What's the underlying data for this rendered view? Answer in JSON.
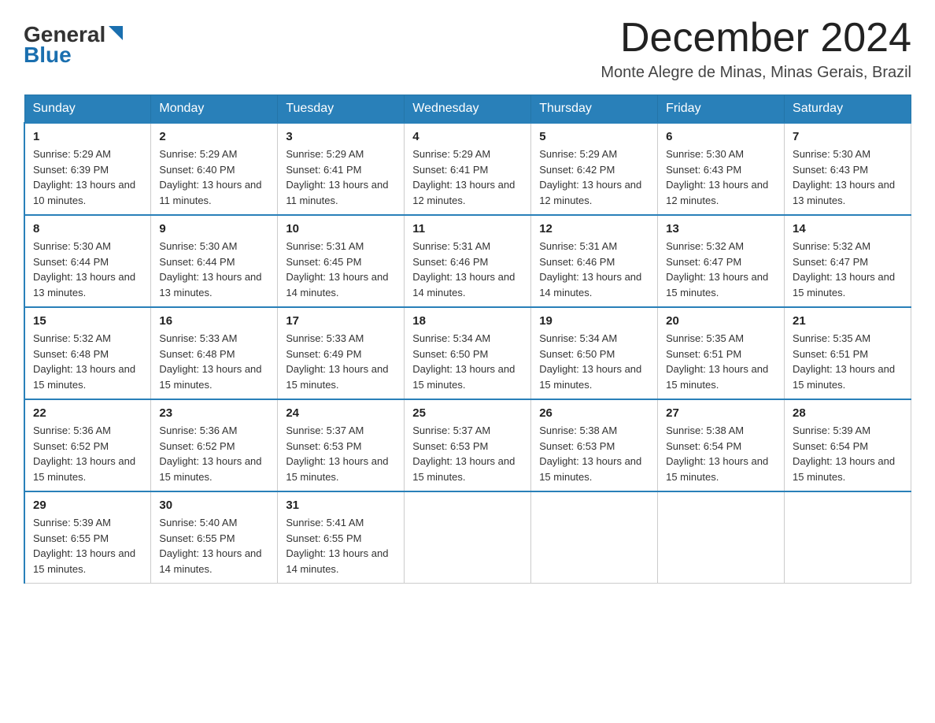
{
  "logo": {
    "line1": "General",
    "line2": "Blue"
  },
  "title": "December 2024",
  "subtitle": "Monte Alegre de Minas, Minas Gerais, Brazil",
  "weekdays": [
    "Sunday",
    "Monday",
    "Tuesday",
    "Wednesday",
    "Thursday",
    "Friday",
    "Saturday"
  ],
  "weeks": [
    [
      {
        "day": "1",
        "sunrise": "5:29 AM",
        "sunset": "6:39 PM",
        "daylight": "13 hours and 10 minutes."
      },
      {
        "day": "2",
        "sunrise": "5:29 AM",
        "sunset": "6:40 PM",
        "daylight": "13 hours and 11 minutes."
      },
      {
        "day": "3",
        "sunrise": "5:29 AM",
        "sunset": "6:41 PM",
        "daylight": "13 hours and 11 minutes."
      },
      {
        "day": "4",
        "sunrise": "5:29 AM",
        "sunset": "6:41 PM",
        "daylight": "13 hours and 12 minutes."
      },
      {
        "day": "5",
        "sunrise": "5:29 AM",
        "sunset": "6:42 PM",
        "daylight": "13 hours and 12 minutes."
      },
      {
        "day": "6",
        "sunrise": "5:30 AM",
        "sunset": "6:43 PM",
        "daylight": "13 hours and 12 minutes."
      },
      {
        "day": "7",
        "sunrise": "5:30 AM",
        "sunset": "6:43 PM",
        "daylight": "13 hours and 13 minutes."
      }
    ],
    [
      {
        "day": "8",
        "sunrise": "5:30 AM",
        "sunset": "6:44 PM",
        "daylight": "13 hours and 13 minutes."
      },
      {
        "day": "9",
        "sunrise": "5:30 AM",
        "sunset": "6:44 PM",
        "daylight": "13 hours and 13 minutes."
      },
      {
        "day": "10",
        "sunrise": "5:31 AM",
        "sunset": "6:45 PM",
        "daylight": "13 hours and 14 minutes."
      },
      {
        "day": "11",
        "sunrise": "5:31 AM",
        "sunset": "6:46 PM",
        "daylight": "13 hours and 14 minutes."
      },
      {
        "day": "12",
        "sunrise": "5:31 AM",
        "sunset": "6:46 PM",
        "daylight": "13 hours and 14 minutes."
      },
      {
        "day": "13",
        "sunrise": "5:32 AM",
        "sunset": "6:47 PM",
        "daylight": "13 hours and 15 minutes."
      },
      {
        "day": "14",
        "sunrise": "5:32 AM",
        "sunset": "6:47 PM",
        "daylight": "13 hours and 15 minutes."
      }
    ],
    [
      {
        "day": "15",
        "sunrise": "5:32 AM",
        "sunset": "6:48 PM",
        "daylight": "13 hours and 15 minutes."
      },
      {
        "day": "16",
        "sunrise": "5:33 AM",
        "sunset": "6:48 PM",
        "daylight": "13 hours and 15 minutes."
      },
      {
        "day": "17",
        "sunrise": "5:33 AM",
        "sunset": "6:49 PM",
        "daylight": "13 hours and 15 minutes."
      },
      {
        "day": "18",
        "sunrise": "5:34 AM",
        "sunset": "6:50 PM",
        "daylight": "13 hours and 15 minutes."
      },
      {
        "day": "19",
        "sunrise": "5:34 AM",
        "sunset": "6:50 PM",
        "daylight": "13 hours and 15 minutes."
      },
      {
        "day": "20",
        "sunrise": "5:35 AM",
        "sunset": "6:51 PM",
        "daylight": "13 hours and 15 minutes."
      },
      {
        "day": "21",
        "sunrise": "5:35 AM",
        "sunset": "6:51 PM",
        "daylight": "13 hours and 15 minutes."
      }
    ],
    [
      {
        "day": "22",
        "sunrise": "5:36 AM",
        "sunset": "6:52 PM",
        "daylight": "13 hours and 15 minutes."
      },
      {
        "day": "23",
        "sunrise": "5:36 AM",
        "sunset": "6:52 PM",
        "daylight": "13 hours and 15 minutes."
      },
      {
        "day": "24",
        "sunrise": "5:37 AM",
        "sunset": "6:53 PM",
        "daylight": "13 hours and 15 minutes."
      },
      {
        "day": "25",
        "sunrise": "5:37 AM",
        "sunset": "6:53 PM",
        "daylight": "13 hours and 15 minutes."
      },
      {
        "day": "26",
        "sunrise": "5:38 AM",
        "sunset": "6:53 PM",
        "daylight": "13 hours and 15 minutes."
      },
      {
        "day": "27",
        "sunrise": "5:38 AM",
        "sunset": "6:54 PM",
        "daylight": "13 hours and 15 minutes."
      },
      {
        "day": "28",
        "sunrise": "5:39 AM",
        "sunset": "6:54 PM",
        "daylight": "13 hours and 15 minutes."
      }
    ],
    [
      {
        "day": "29",
        "sunrise": "5:39 AM",
        "sunset": "6:55 PM",
        "daylight": "13 hours and 15 minutes."
      },
      {
        "day": "30",
        "sunrise": "5:40 AM",
        "sunset": "6:55 PM",
        "daylight": "13 hours and 14 minutes."
      },
      {
        "day": "31",
        "sunrise": "5:41 AM",
        "sunset": "6:55 PM",
        "daylight": "13 hours and 14 minutes."
      },
      {
        "day": "",
        "sunrise": "",
        "sunset": "",
        "daylight": ""
      },
      {
        "day": "",
        "sunrise": "",
        "sunset": "",
        "daylight": ""
      },
      {
        "day": "",
        "sunrise": "",
        "sunset": "",
        "daylight": ""
      },
      {
        "day": "",
        "sunrise": "",
        "sunset": "",
        "daylight": ""
      }
    ]
  ]
}
